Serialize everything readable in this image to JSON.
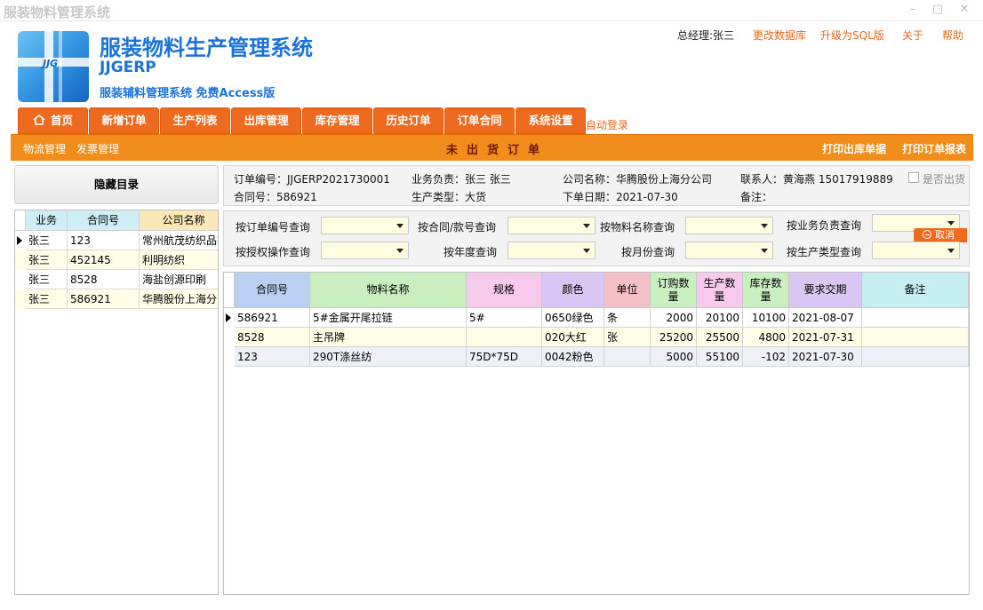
{
  "window": {
    "title": "服装物料管理系统",
    "controls": [
      "–",
      "▢",
      "✕"
    ]
  },
  "header": {
    "logo_text": "JJG",
    "title": "服装物料生产管理系统",
    "subtitle": "JJGERP",
    "description": "服装辅料管理系统 免费Access版",
    "user": "总经理:张三",
    "links": [
      "更改数据库",
      "升级为SQL版",
      "关于",
      "帮助"
    ]
  },
  "nav": {
    "tabs": [
      "首页",
      "新增订单",
      "生产列表",
      "出库管理",
      "库存管理",
      "历史订单",
      "订单合同",
      "系统设置"
    ],
    "autologin": "自动登录"
  },
  "toolbar": {
    "left": [
      "物流管理",
      "发票管理"
    ],
    "center": "未出货订单",
    "right": [
      "打印出库单据",
      "打印订单报表"
    ]
  },
  "left_panel": {
    "hide_label": "隐藏目录",
    "columns": [
      "业务",
      "合同号",
      "公司名称"
    ],
    "rows": [
      [
        "张三",
        "123",
        "常州航茂纺织品有"
      ],
      [
        "张三",
        "452145",
        "利明纺织"
      ],
      [
        "张三",
        "8528",
        "海盐创源印刷"
      ],
      [
        "张三",
        "586921",
        "华腾股份上海分公"
      ]
    ]
  },
  "order_info": {
    "order_no": "订单编号：JJGERP2021730001",
    "salesman": "业务负责：张三  张三",
    "company": "公司名称：华腾股份上海分公司",
    "contact": "联系人：黄海燕  15017919889",
    "shipped_label": "是否出货",
    "contract_no": "合同号：586921",
    "prod_type": "生产类型：大货",
    "order_date": "下单日期：2021-07-30",
    "remark": "备注："
  },
  "search": {
    "labels": [
      "按订单编号查询",
      "按合同/款号查询",
      "按物料名称查询",
      "按业务负责查询",
      "按授权操作查询",
      "按年度查询",
      "按月份查询",
      "按生产类型查询"
    ],
    "cancel": "取消"
  },
  "main_grid": {
    "columns": [
      "合同号",
      "物料名称",
      "规格",
      "颜色",
      "单位",
      "订购数量",
      "生产数量",
      "库存数量",
      "要求交期",
      "备注"
    ],
    "rows": [
      [
        "586921",
        "5#金属开尾拉链",
        "5#",
        "0650绿色",
        "条",
        "2000",
        "20100",
        "10100",
        "2021-08-07",
        ""
      ],
      [
        "8528",
        "主吊牌",
        "",
        "020大红",
        "张",
        "25200",
        "25500",
        "4800",
        "2021-07-31",
        ""
      ],
      [
        "123",
        "290T涤丝纺",
        "75D*75D",
        "0042粉色",
        "",
        "5000",
        "55100",
        "-102",
        "2021-07-30",
        ""
      ]
    ]
  },
  "colors": {
    "accent": "#ee6a1e",
    "toolbar": "#f28c1a",
    "title_blue": "#1a73d9",
    "link": "#e8681c"
  }
}
